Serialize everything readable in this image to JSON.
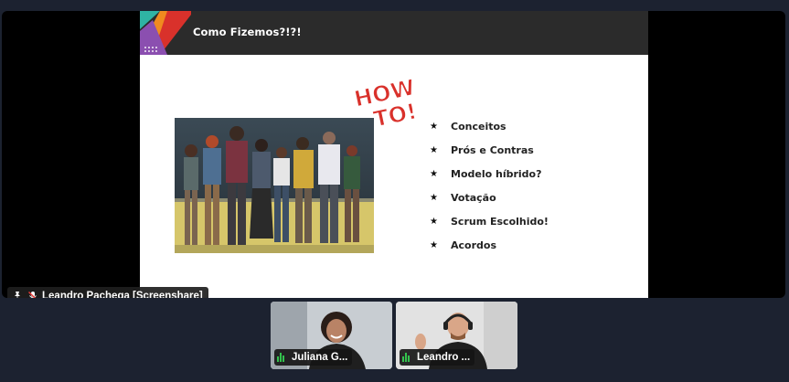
{
  "slide": {
    "title": "Como Fizemos?!?!",
    "howto_logo": "How To!",
    "bullet_symbol": "★",
    "bullets": [
      "Conceitos",
      "Prós e Contras",
      "Modelo híbrido?",
      "Votação",
      "Scrum Escolhido!",
      "Acordos"
    ]
  },
  "screenshare": {
    "label": "Leandro Pachega [Screenshare]",
    "icons": [
      "pin-icon",
      "mic-muted-icon"
    ]
  },
  "participants": [
    {
      "name": "Juliana G...",
      "icon": "audio-level-icon"
    },
    {
      "name": "Leandro ...",
      "icon": "audio-level-icon"
    }
  ],
  "colors": {
    "background": "#1c2230",
    "slide_header": "#2b2b2b",
    "audio_indicator": "#33c24d",
    "logo_orange": "#f08a1f",
    "logo_teal": "#2fb3a4",
    "logo_red": "#d9312b"
  }
}
